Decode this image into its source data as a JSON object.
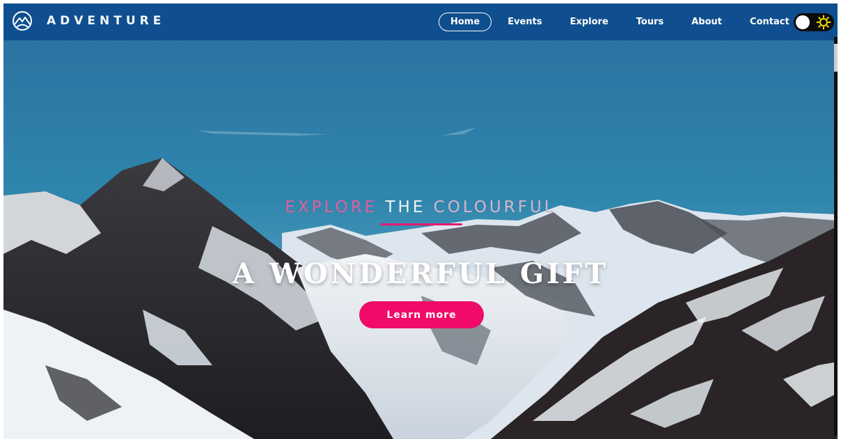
{
  "navbar": {
    "brand": "ADVENTURE",
    "brand_icon": "mountain-logo-icon",
    "items": [
      {
        "label": "Home",
        "active": true
      },
      {
        "label": "Events",
        "active": false
      },
      {
        "label": "Explore",
        "active": false
      },
      {
        "label": "Tours",
        "active": false
      },
      {
        "label": "About",
        "active": false
      },
      {
        "label": "Contact",
        "active": false
      }
    ],
    "theme_toggle": {
      "icon": "sun-icon",
      "state": "light"
    }
  },
  "hero": {
    "eyebrow": {
      "w1": "EXPLORE",
      "w2": "THE",
      "w3": "COLOURFUL"
    },
    "headline": "A WONDERFUL GIFT",
    "cta_label": "Learn more"
  },
  "colors": {
    "nav_bg": "#0f4f8f",
    "accent": "#f10a67",
    "eyebrow_pink": "#e35d9b",
    "sky": "#2f7aa3"
  }
}
